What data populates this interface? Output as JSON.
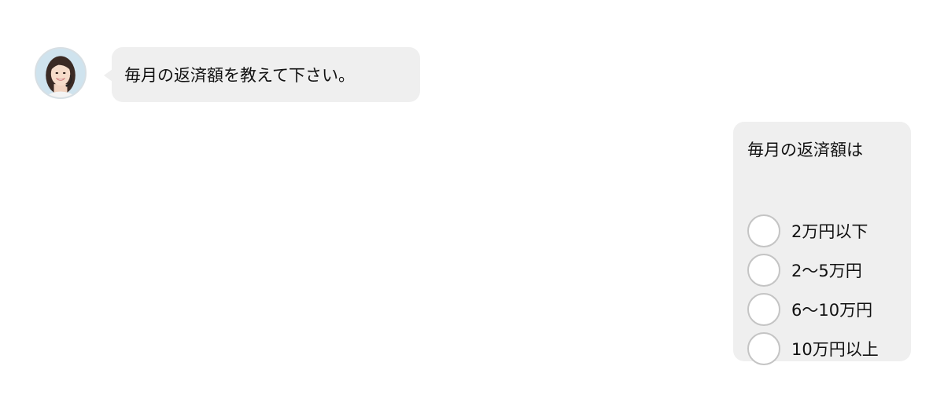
{
  "agent": {
    "avatar_icon": "operator-avatar-icon",
    "message": "毎月の返済額を教えて下さい。"
  },
  "reply": {
    "question": "毎月の返済額は",
    "options": [
      {
        "label": "2万円以下"
      },
      {
        "label": "2〜5万円"
      },
      {
        "label": "6〜10万円"
      },
      {
        "label": "10万円以上"
      }
    ]
  },
  "colors": {
    "bubble": "#efefef",
    "radio_border": "#c4c4c4",
    "background": "#ffffff"
  }
}
